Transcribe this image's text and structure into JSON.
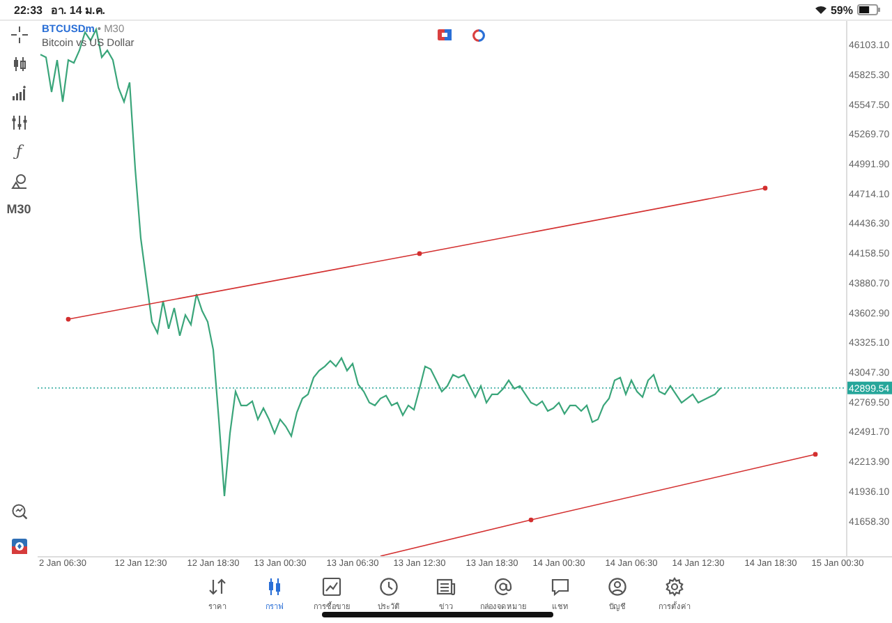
{
  "status_bar": {
    "time": "22:33",
    "date": "อา. 14 ม.ค.",
    "battery": "59%"
  },
  "toolbar": {
    "items": [
      {
        "kind": "crosshair"
      },
      {
        "kind": "candles"
      },
      {
        "kind": "indicators"
      },
      {
        "kind": "sliders"
      },
      {
        "kind": "function",
        "glyph": "ƒ"
      },
      {
        "kind": "shapes"
      },
      {
        "kind": "text",
        "label": "M30"
      }
    ],
    "bottom": [
      {
        "kind": "zoom"
      },
      {
        "kind": "logo"
      }
    ]
  },
  "legend": {
    "symbol": "BTCUSDm",
    "separator": "•",
    "timeframe": "M30",
    "description": "Bitcoin vs US Dollar"
  },
  "chart": {
    "chart_data": {
      "type": "line",
      "categories": [
        null,
        null,
        null,
        null,
        "2 Jan 06:30",
        null,
        null,
        null,
        null,
        null,
        null,
        null,
        null,
        null,
        null,
        null,
        null,
        null,
        "12 Jan 12:30",
        null,
        null,
        null,
        null,
        null,
        null,
        null,
        null,
        null,
        null,
        null,
        null,
        "12 Jan 18:30",
        null,
        null,
        null,
        null,
        null,
        null,
        null,
        null,
        null,
        null,
        null,
        "13 Jan 00:30",
        null,
        null,
        null,
        null,
        null,
        null,
        null,
        null,
        null,
        null,
        null,
        null,
        "13 Jan 06:30",
        null,
        null,
        null,
        null,
        null,
        null,
        null,
        null,
        null,
        null,
        null,
        "13 Jan 12:30",
        null,
        null,
        null,
        null,
        null,
        null,
        null,
        null,
        null,
        null,
        null,
        null,
        "13 Jan 18:30",
        null,
        null,
        null,
        null,
        null,
        null,
        null,
        null,
        null,
        null,
        null,
        "14 Jan 00:30",
        null,
        null,
        null,
        null,
        null,
        null,
        null,
        null,
        null,
        null,
        null,
        null,
        "14 Jan 06:30",
        null,
        null,
        null,
        null,
        null,
        null,
        null,
        null,
        null,
        null,
        null,
        "14 Jan 12:30",
        null,
        null,
        null,
        null,
        null,
        null,
        null,
        null,
        null,
        null,
        null,
        null,
        "14 Jan 18:30",
        null,
        null,
        null,
        null,
        null,
        null,
        null,
        null,
        null,
        null,
        null,
        "15 Jan 00:30",
        null
      ],
      "series": [
        {
          "color": "#3aa57a",
          "values": [
            46012,
            45986,
            45661,
            45960,
            45570,
            45960,
            45934,
            46051,
            46220,
            46142,
            46246,
            45986,
            46051,
            45960,
            45700,
            45570,
            45752,
            44946,
            44296,
            43906,
            43516,
            43412,
            43711,
            43451,
            43646,
            43386,
            43581,
            43490,
            43776,
            43620,
            43516,
            43256,
            42606,
            41891,
            42476,
            42866,
            42736,
            42736,
            42775,
            42606,
            42710,
            42606,
            42476,
            42606,
            42541,
            42450,
            42671,
            42801,
            42840,
            42996,
            43061,
            43100,
            43152,
            43100,
            43178,
            43061,
            43126,
            42931,
            42866,
            42762,
            42736,
            42801,
            42827,
            42736,
            42762,
            42645,
            42736,
            42697,
            42892,
            43100,
            43074,
            42970,
            42866,
            42918,
            43022,
            42996,
            43022,
            42918,
            42814,
            42918,
            42762,
            42840,
            42840,
            42892,
            42970,
            42892,
            42918,
            42840,
            42762,
            42736,
            42775,
            42684,
            42710,
            42762,
            42658,
            42736,
            42736,
            42684,
            42736,
            42580,
            42606,
            42736,
            42801,
            42970,
            42996,
            42840,
            42970,
            42866,
            42814,
            42970,
            43022,
            42866,
            42840,
            42918,
            42840,
            42762,
            42801,
            42840,
            42762,
            42788,
            42814,
            42840,
            42899,
            null,
            null,
            null,
            null,
            null,
            null,
            null,
            null,
            null,
            null,
            null,
            null,
            null,
            null,
            null,
            null,
            null,
            null,
            null,
            null,
            null,
            null
          ]
        },
        {
          "color": "#d32f2f",
          "marker": "circle",
          "values": [
            null,
            null,
            null,
            null,
            null,
            43541,
            null,
            null,
            null,
            null,
            null,
            null,
            null,
            null,
            null,
            null,
            null,
            null,
            null,
            null,
            null,
            null,
            null,
            null,
            null,
            null,
            null,
            null,
            null,
            null,
            null,
            null,
            null,
            null,
            null,
            null,
            null,
            null,
            null,
            null,
            null,
            null,
            null,
            null,
            null,
            null,
            null,
            null,
            null,
            null,
            null,
            null,
            null,
            null,
            null,
            null,
            null,
            null,
            null,
            null,
            null,
            null,
            null,
            null,
            null,
            null,
            null,
            null,
            44153,
            null,
            null,
            null,
            null,
            null,
            null,
            null,
            null,
            null,
            null,
            null,
            null,
            null,
            null,
            null,
            null,
            null,
            null,
            null,
            null,
            null,
            null,
            null,
            null,
            null,
            null,
            null,
            null,
            null,
            null,
            null,
            null,
            null,
            null,
            null,
            null,
            null,
            null,
            null,
            null,
            null,
            null,
            null,
            null,
            null,
            null,
            null,
            null,
            null,
            null,
            null,
            null,
            null,
            null,
            null,
            null,
            null,
            null,
            null,
            null,
            null,
            44764,
            null,
            null,
            null,
            null,
            null,
            null,
            null,
            null,
            null,
            null,
            null,
            null,
            null,
            null
          ]
        },
        {
          "color": "#d32f2f",
          "marker": "circle",
          "values": [
            null,
            null,
            null,
            null,
            null,
            null,
            null,
            null,
            null,
            null,
            null,
            null,
            null,
            null,
            null,
            null,
            null,
            null,
            null,
            null,
            null,
            null,
            null,
            null,
            null,
            null,
            null,
            null,
            null,
            null,
            null,
            null,
            null,
            null,
            null,
            null,
            null,
            null,
            null,
            null,
            null,
            null,
            null,
            null,
            null,
            null,
            null,
            null,
            null,
            null,
            null,
            null,
            null,
            null,
            null,
            null,
            null,
            null,
            null,
            null,
            null,
            41330,
            null,
            null,
            null,
            null,
            null,
            null,
            null,
            null,
            null,
            null,
            null,
            null,
            null,
            null,
            null,
            null,
            null,
            null,
            null,
            null,
            null,
            null,
            null,
            null,
            null,
            null,
            41668,
            null,
            null,
            null,
            null,
            null,
            null,
            null,
            null,
            null,
            null,
            null,
            null,
            null,
            null,
            null,
            null,
            null,
            null,
            null,
            null,
            null,
            null,
            null,
            null,
            null,
            null,
            null,
            null,
            null,
            null,
            null,
            null,
            null,
            null,
            null,
            null,
            null,
            null,
            null,
            null,
            null,
            null,
            null,
            null,
            null,
            null,
            null,
            null,
            null,
            null,
            42280,
            null,
            null,
            null,
            null,
            null
          ]
        }
      ],
      "ref_lines": [
        {
          "axis": "y",
          "value": 42899.54,
          "label": "42899.54",
          "color": "#26a69a"
        }
      ],
      "ylim": [
        41330,
        46325
      ],
      "yticks": [
        {
          "value": 46103.1,
          "label": "46103.10"
        },
        {
          "value": 45825.3,
          "label": "45825.30"
        },
        {
          "value": 45547.5,
          "label": "45547.50"
        },
        {
          "value": 45269.7,
          "label": "45269.70"
        },
        {
          "value": 44991.9,
          "label": "44991.90"
        },
        {
          "value": 44714.1,
          "label": "44714.10"
        },
        {
          "value": 44436.3,
          "label": "44436.30"
        },
        {
          "value": 44158.5,
          "label": "44158.50"
        },
        {
          "value": 43880.7,
          "label": "43880.70"
        },
        {
          "value": 43602.9,
          "label": "43602.90"
        },
        {
          "value": 43325.1,
          "label": "43325.10"
        },
        {
          "value": 43047.3,
          "label": "43047.30"
        },
        {
          "value": 42769.5,
          "label": "42769.50"
        },
        {
          "value": 42491.7,
          "label": "42491.70"
        },
        {
          "value": 42213.9,
          "label": "42213.90"
        },
        {
          "value": 41936.1,
          "label": "41936.10"
        },
        {
          "value": 41658.3,
          "label": "41658.30"
        }
      ]
    }
  },
  "tabs": [
    {
      "kind": "quotes",
      "label": "ราคา",
      "selected": false
    },
    {
      "kind": "chart",
      "label": "กราฟ",
      "selected": true
    },
    {
      "kind": "trade",
      "label": "การซื้อขาย",
      "selected": false
    },
    {
      "kind": "history",
      "label": "ประวัติ",
      "selected": false
    },
    {
      "kind": "news",
      "label": "ข่าว",
      "selected": false
    },
    {
      "kind": "mail",
      "label": "กล่องจดหมาย",
      "selected": false
    },
    {
      "kind": "chat",
      "label": "แชท",
      "selected": false
    },
    {
      "kind": "account",
      "label": "บัญชี",
      "selected": false
    },
    {
      "kind": "settings",
      "label": "การตั้งค่า",
      "selected": false
    }
  ]
}
